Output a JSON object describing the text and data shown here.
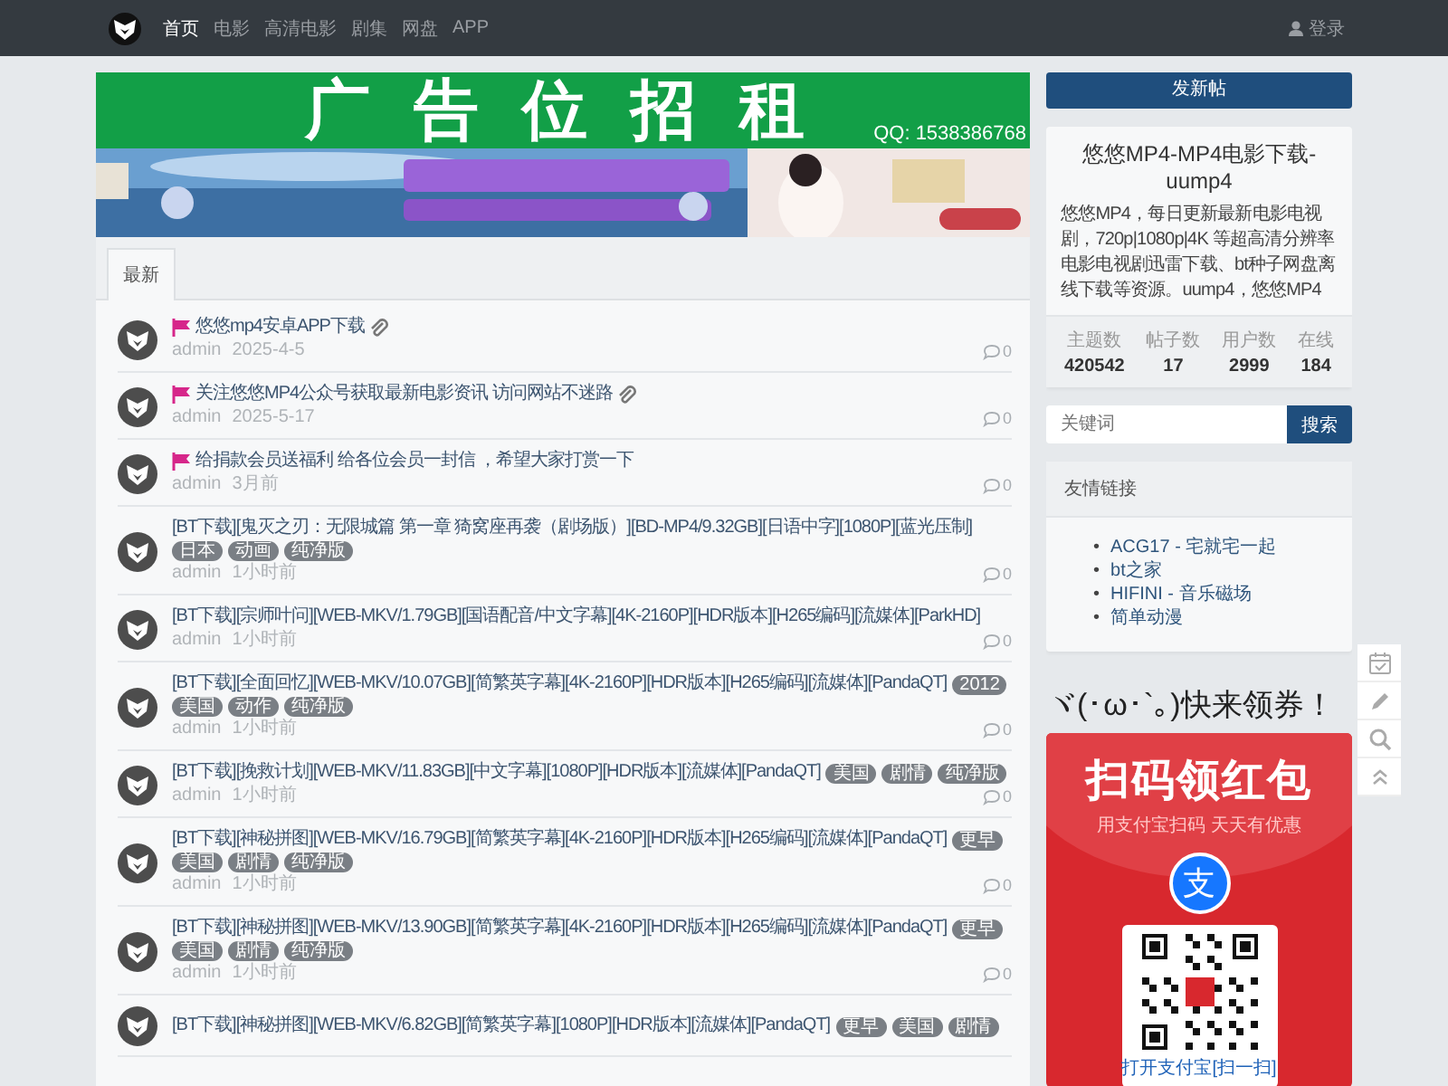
{
  "nav": {
    "items": [
      {
        "label": "首页",
        "selected": true
      },
      {
        "label": "电影",
        "selected": false
      },
      {
        "label": "高清电影",
        "selected": false
      },
      {
        "label": "剧集",
        "selected": false
      },
      {
        "label": "网盘",
        "selected": false
      },
      {
        "label": "APP",
        "selected": false
      }
    ],
    "login": "登录"
  },
  "ad": {
    "title": "广告位招租",
    "contact": "QQ: 1538386768"
  },
  "tabs": [
    {
      "label": "最新",
      "selected": true
    }
  ],
  "posts": [
    {
      "title": "悠悠mp4安卓APP下载",
      "pinned": true,
      "attachment": true,
      "author": "admin",
      "time": "2025-4-5",
      "comments": "0"
    },
    {
      "title": "关注悠悠MP4公众号获取最新电影资讯 访问网站不迷路",
      "pinned": true,
      "attachment": true,
      "author": "admin",
      "time": "2025-5-17",
      "comments": "0"
    },
    {
      "title": "给捐款会员送福利 给各位会员一封信 ，希望大家打赏一下",
      "pinned": true,
      "attachment": false,
      "author": "admin",
      "time": "3月前",
      "comments": "0"
    },
    {
      "title": "[BT下载][鬼灭之刃：无限城篇 第一章 猗窝座再袭（剧场版）][BD-MP4/9.32GB][日语中字][1080P][蓝光压制]",
      "pinned": false,
      "attachment": false,
      "tags": [
        "日本",
        "动画",
        "纯净版"
      ],
      "author": "admin",
      "time": "1小时前",
      "comments": "0"
    },
    {
      "title": "[BT下载][宗师叶问][WEB-MKV/1.79GB][国语配音/中文字幕][4K-2160P][HDR版本][H265编码][流媒体][ParkHD]",
      "pinned": false,
      "attachment": false,
      "author": "admin",
      "time": "1小时前",
      "comments": "0"
    },
    {
      "title": "[BT下载][全面回忆][WEB-MKV/10.07GB][简繁英字幕][4K-2160P][HDR版本][H265编码][流媒体][PandaQT]",
      "pinned": false,
      "attachment": false,
      "tags": [
        "2012",
        "美国",
        "动作",
        "纯净版"
      ],
      "author": "admin",
      "time": "1小时前",
      "comments": "0"
    },
    {
      "title": "[BT下载][挽救计划][WEB-MKV/11.83GB][中文字幕][1080P][HDR版本][流媒体][PandaQT]",
      "pinned": false,
      "attachment": false,
      "tags": [
        "美国",
        "剧情",
        "纯净版"
      ],
      "author": "admin",
      "time": "1小时前",
      "comments": "0"
    },
    {
      "title": "[BT下载][神秘拼图][WEB-MKV/16.79GB][简繁英字幕][4K-2160P][HDR版本][H265编码][流媒体][PandaQT]",
      "pinned": false,
      "attachment": false,
      "tags": [
        "更早",
        "美国",
        "剧情",
        "纯净版"
      ],
      "author": "admin",
      "time": "1小时前",
      "comments": "0"
    },
    {
      "title": "[BT下载][神秘拼图][WEB-MKV/13.90GB][简繁英字幕][4K-2160P][HDR版本][H265编码][流媒体][PandaQT]",
      "pinned": false,
      "attachment": false,
      "tags": [
        "更早",
        "美国",
        "剧情",
        "纯净版"
      ],
      "author": "admin",
      "time": "1小时前",
      "comments": "0"
    },
    {
      "title": "[BT下载][神秘拼图][WEB-MKV/6.82GB][简繁英字幕][1080P][HDR版本][流媒体][PandaQT]",
      "pinned": false,
      "attachment": false,
      "tags": [
        "更早",
        "美国",
        "剧情"
      ]
    }
  ],
  "sidebar": {
    "new_post": "发新帖",
    "site": {
      "title": "悠悠MP4-MP4电影下载-uump4",
      "description": "悠悠MP4，每日更新最新电影电视剧，720p|1080p|4K 等超高清分辨率电影电视剧迅雷下载、bt种子网盘离线下载等资源。uump4，悠悠MP4",
      "stats": [
        {
          "label": "主题数",
          "value": "420542"
        },
        {
          "label": "帖子数",
          "value": "17"
        },
        {
          "label": "用户数",
          "value": "2999"
        },
        {
          "label": "在线",
          "value": "184"
        }
      ]
    },
    "search": {
      "placeholder": "关键词",
      "button": "搜索"
    },
    "links": {
      "title": "友情链接",
      "items": [
        {
          "bullet": "•",
          "label": "ACG17 - 宅就宅一起"
        },
        {
          "bullet": "•",
          "label": "bt之家"
        },
        {
          "bullet": "•",
          "label": "HIFINI - 音乐磁场"
        },
        {
          "bullet": "•",
          "label": "简单动漫"
        }
      ]
    },
    "coupon": {
      "heading": "ヾ(･ω･`｡)快来领券！",
      "title": "扫码领红包",
      "subtitle": "用支付宝扫码 天天有优惠",
      "pay_mark": "支",
      "caption": "打开支付宝[扫一扫]"
    }
  }
}
